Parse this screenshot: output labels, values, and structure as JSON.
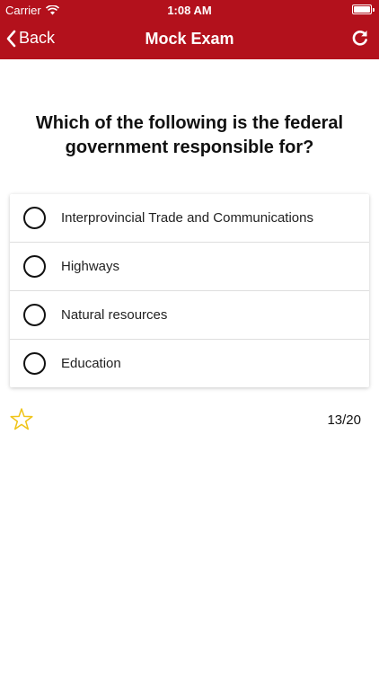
{
  "status_bar": {
    "carrier": "Carrier",
    "time": "1:08 AM"
  },
  "nav": {
    "back_label": "Back",
    "title": "Mock Exam"
  },
  "question": {
    "text": "Which of the following is the federal government responsible for?"
  },
  "options": [
    {
      "label": "Interprovincial Trade and Communications"
    },
    {
      "label": "Highways"
    },
    {
      "label": "Natural resources"
    },
    {
      "label": "Education"
    }
  ],
  "footer": {
    "progress": "13/20"
  },
  "colors": {
    "header_bg": "#b3111c",
    "star_outline": "#f0c419"
  }
}
